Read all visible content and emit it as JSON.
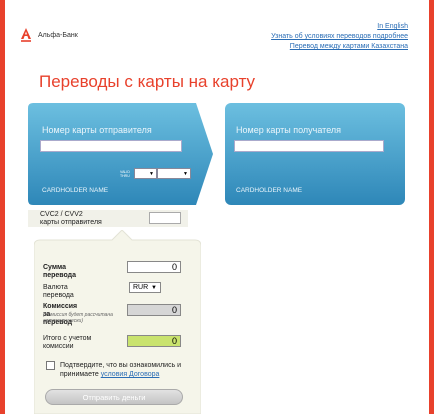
{
  "brand": {
    "name": "Альфа-Банк",
    "accent": "#e8412c"
  },
  "links": {
    "english": "In English",
    "conditions": "Узнать об условиях переводов подробнее",
    "kazakhstan": "Перевод между картами Казахстана"
  },
  "title": "Переводы с карты на карту",
  "sender_card": {
    "label": "Номер карты отправителя",
    "valid_label": "VALID THRU",
    "holder": "CARDHOLDER NAME",
    "color": "#3a97c4"
  },
  "receiver_card": {
    "label": "Номер карты получателя",
    "holder": "CARDHOLDER NAME",
    "color": "#3a97c4"
  },
  "cvc": {
    "label": "CVC2 / CVV2\nкарты отправителя"
  },
  "form": {
    "amount_label": "Сумма перевода",
    "amount_value": "0",
    "currency_label": "Валюта перевода",
    "currency_value": "RUR",
    "fee_label": "Комиссия за перевод",
    "fee_hint": "(Комиссия будет рассчитана автоматически)",
    "fee_value": "0",
    "total_label": "Итого с учетом комиссии",
    "total_value": "0",
    "agree_text": "Подтвердите, что вы ознакомились и принимаете",
    "agree_link": "условия Договора",
    "submit": "Отправить деньги"
  }
}
